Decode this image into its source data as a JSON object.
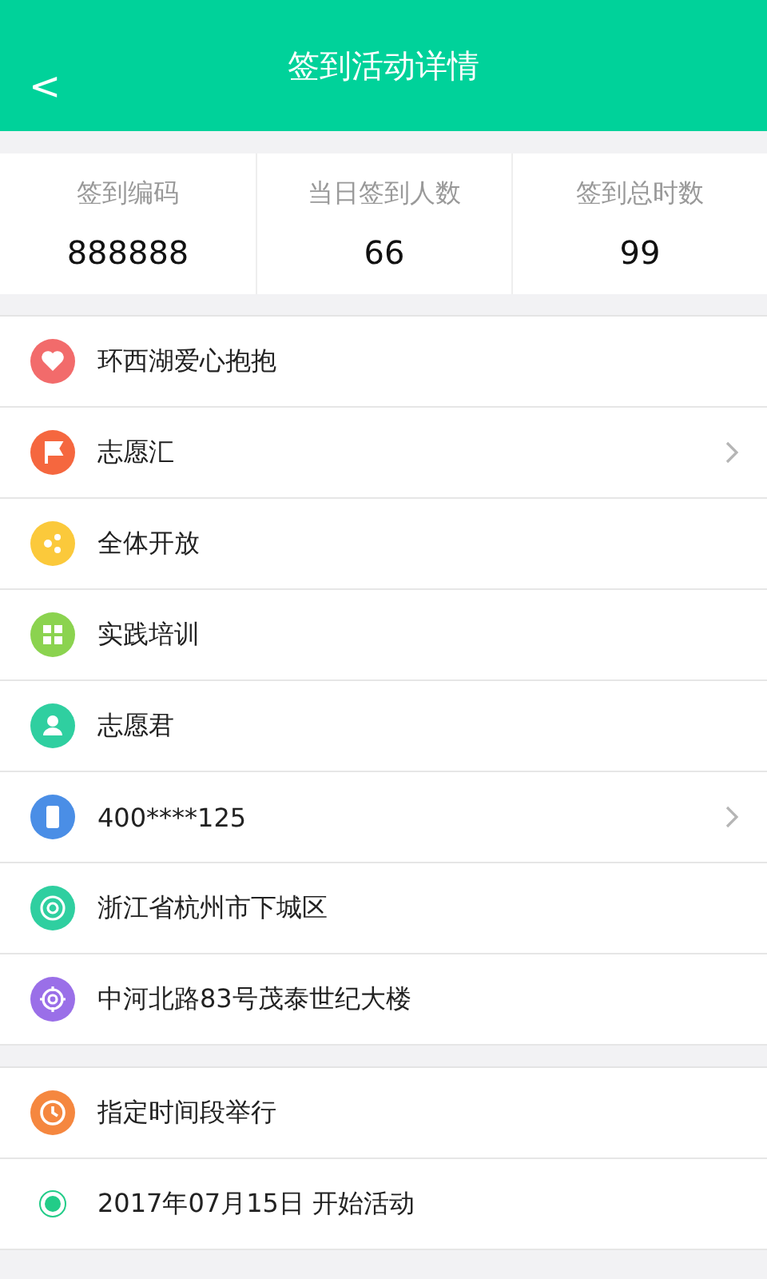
{
  "header": {
    "back": "<",
    "title": "签到活动详情"
  },
  "stats": [
    {
      "label": "签到编码",
      "value": "888888"
    },
    {
      "label": "当日签到人数",
      "value": "66"
    },
    {
      "label": "签到总时数",
      "value": "99"
    }
  ],
  "info_rows": [
    {
      "text": "环西湖爱心抱抱",
      "color": "#f26b6b",
      "chevron": false
    },
    {
      "text": "志愿汇",
      "color": "#f5673f",
      "chevron": true
    },
    {
      "text": "全体开放",
      "color": "#fbc93b",
      "chevron": false
    },
    {
      "text": "实践培训",
      "color": "#8bd34f",
      "chevron": false
    },
    {
      "text": "志愿君",
      "color": "#2fcfa0",
      "chevron": false
    },
    {
      "text": "400****125",
      "color": "#4a8ee6",
      "chevron": true
    },
    {
      "text": "浙江省杭州市下城区",
      "color": "#2fcfa0",
      "chevron": false
    },
    {
      "text": "中河北路83号茂泰世纪大楼",
      "color": "#9a6fe8",
      "chevron": false
    }
  ],
  "time_rows": [
    {
      "kind": "icon",
      "text": "指定时间段举行",
      "color": "#f5873f"
    },
    {
      "kind": "dot",
      "text": "2017年07月15日 开始活动",
      "color": "#22cc88"
    }
  ]
}
